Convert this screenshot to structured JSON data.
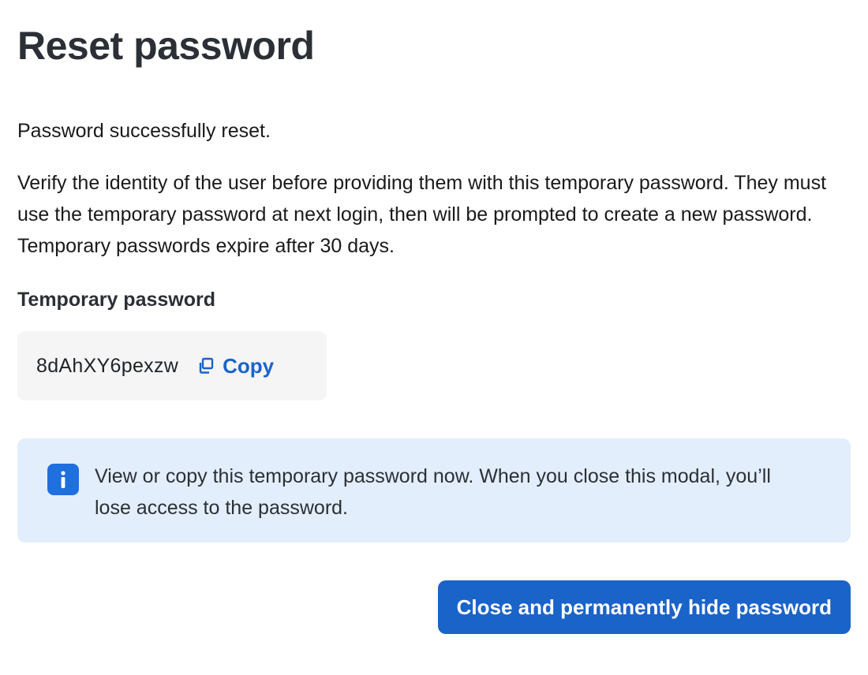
{
  "modal": {
    "title": "Reset password",
    "success_message": "Password successfully reset.",
    "instructions": "Verify the identity of the user before providing them with this temporary password. They must use the temporary password at next login, then will be prompted to create a new password. Temporary passwords expire after 30 days.",
    "password_label": "Temporary password",
    "password_value": "8dAhXY6pexzw",
    "copy_label": "Copy",
    "copy_icon": "copy-icon",
    "info_icon": "info-icon",
    "info_message": "View or copy this temporary password now. When you close this modal, you’ll lose access to the password.",
    "close_button_label": "Close and permanently hide password"
  },
  "colors": {
    "accent": "#1a63c9",
    "info_background": "#e3eefc",
    "password_box_background": "#f5f5f5",
    "title": "#2b2f36"
  }
}
